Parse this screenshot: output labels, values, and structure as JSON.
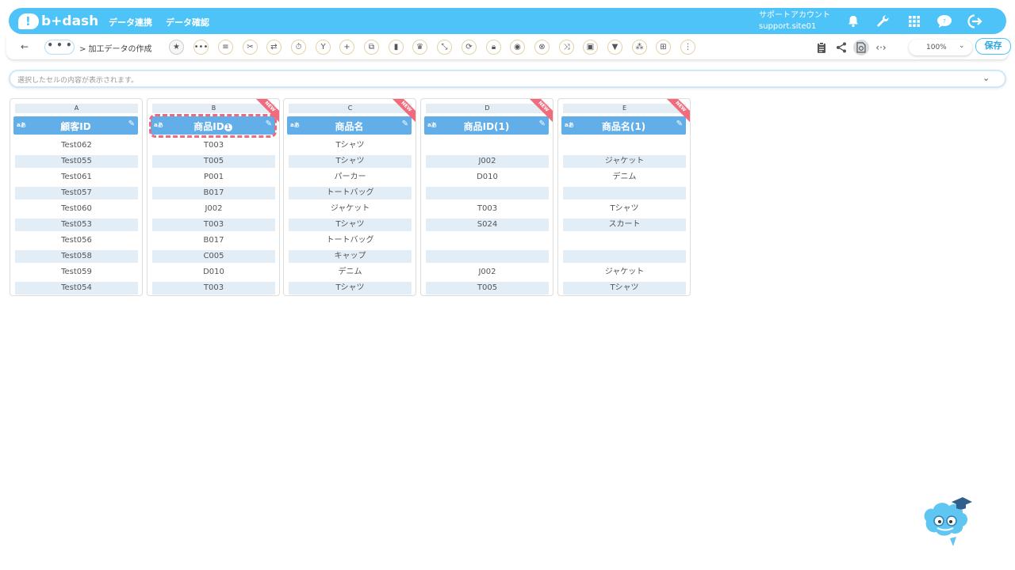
{
  "header": {
    "logo": "b+dash",
    "nav": [
      "データ連携",
      "データ確認"
    ],
    "account_line1": "サポートアカウント",
    "account_line2": "support.site01"
  },
  "toolbar": {
    "back": "←",
    "more": "• • •",
    "breadcrumb": "> 加工データの作成",
    "zoom": "100%",
    "save_label": "保存"
  },
  "cellbar": {
    "placeholder": "選択したセルの内容が表示されます。"
  },
  "colors": {
    "brand": "#4dc3f7",
    "column_header": "#62aee9",
    "new_ribbon": "#f06b7b",
    "selection_dash": "#ee6b7f"
  },
  "columns": [
    {
      "letter": "A",
      "type": "aあ",
      "name": "顧客ID",
      "badge": "",
      "is_new": false,
      "cells": [
        "Test062",
        "Test055",
        "Test061",
        "Test057",
        "Test060",
        "Test053",
        "Test056",
        "Test058",
        "Test059",
        "Test054"
      ]
    },
    {
      "letter": "B",
      "type": "aあ",
      "name": "商品ID",
      "badge": "1",
      "is_new": true,
      "selected": true,
      "cells": [
        "T003",
        "T005",
        "P001",
        "B017",
        "J002",
        "T003",
        "B017",
        "C005",
        "D010",
        "T003"
      ]
    },
    {
      "letter": "C",
      "type": "aあ",
      "name": "商品名",
      "badge": "",
      "is_new": true,
      "cells": [
        "Tシャツ",
        "Tシャツ",
        "パーカー",
        "トートバッグ",
        "ジャケット",
        "Tシャツ",
        "トートバッグ",
        "キャップ",
        "デニム",
        "Tシャツ"
      ]
    },
    {
      "letter": "D",
      "type": "aあ",
      "name": "商品ID(1)",
      "badge": "",
      "is_new": true,
      "cells": [
        "",
        "J002",
        "D010",
        "",
        "T003",
        "S024",
        "",
        "",
        "J002",
        "T005"
      ]
    },
    {
      "letter": "E",
      "type": "aあ",
      "name": "商品名(1)",
      "badge": "",
      "is_new": true,
      "cells": [
        "",
        "ジャケット",
        "デニム",
        "",
        "Tシャツ",
        "スカート",
        "",
        "",
        "ジャケット",
        "Tシャツ"
      ]
    }
  ],
  "new_label": "NEW"
}
